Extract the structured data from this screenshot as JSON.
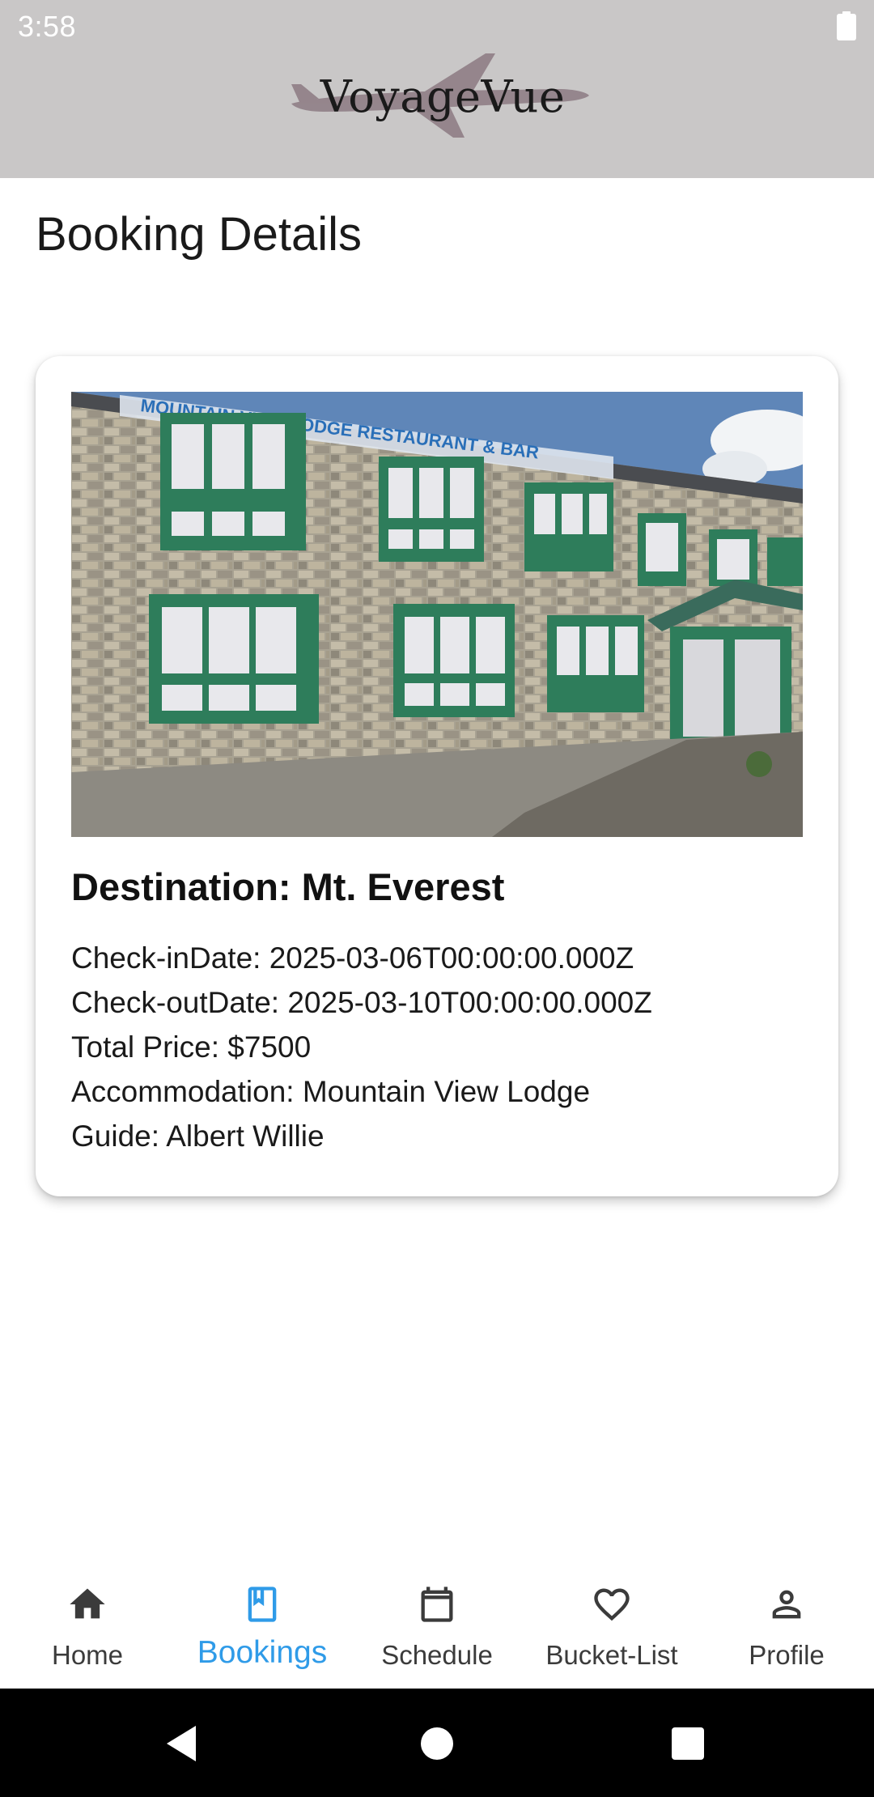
{
  "status_bar": {
    "time": "3:58",
    "battery_icon": "battery-full-icon"
  },
  "header": {
    "logo_text": "VoyageVue",
    "logo_icon": "airplane-icon",
    "background": "#c9c7c7"
  },
  "page": {
    "title": "Booking Details"
  },
  "booking": {
    "destination_label": "Destination: Mt. Everest",
    "details": [
      "Check-inDate: 2025-03-06T00:00:00.000Z",
      "Check-outDate: 2025-03-10T00:00:00.000Z",
      "Total Price: $7500",
      "Accommodation: Mountain View Lodge",
      "Guide: Albert Willie"
    ],
    "photo_sign_text": "MOUNTAIN VIEW LODGE RESTAURANT & BAR"
  },
  "bottom_nav": {
    "active_color": "#2f9be8",
    "items": [
      {
        "label": "Home",
        "icon": "home-icon",
        "active": false
      },
      {
        "label": "Bookings",
        "icon": "bookmark-icon",
        "active": true
      },
      {
        "label": "Schedule",
        "icon": "calendar-icon",
        "active": false
      },
      {
        "label": "Bucket-List",
        "icon": "heart-icon",
        "active": false
      },
      {
        "label": "Profile",
        "icon": "person-icon",
        "active": false
      }
    ]
  },
  "system_nav": {
    "back_icon": "back-triangle-icon",
    "home_icon": "home-circle-icon",
    "recents_icon": "recents-square-icon"
  }
}
